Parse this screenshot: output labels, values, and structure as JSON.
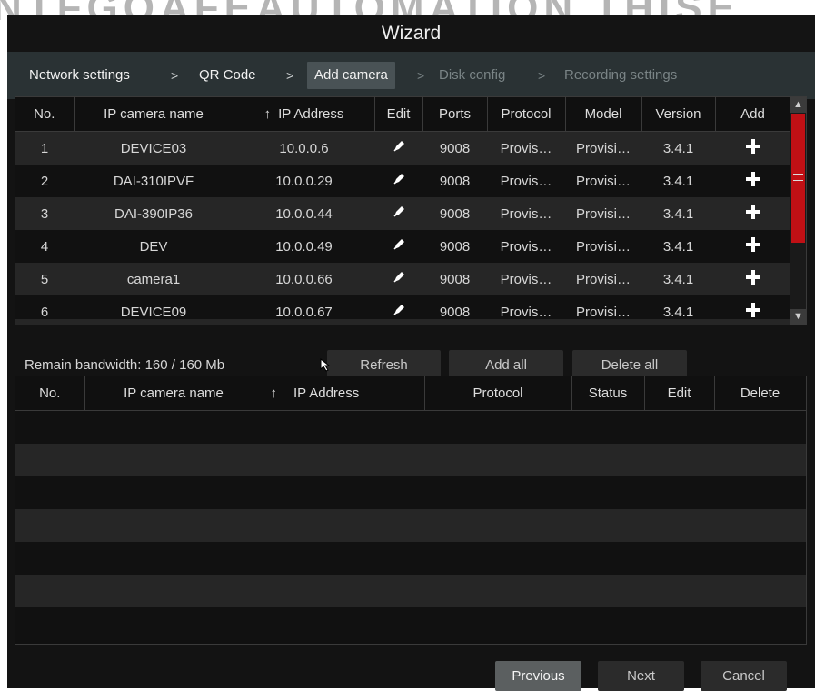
{
  "window": {
    "title": "Wizard"
  },
  "steps": [
    {
      "label": "Network settings",
      "state": "done"
    },
    {
      "label": "QR Code",
      "state": "done"
    },
    {
      "label": "Add camera",
      "state": "active"
    },
    {
      "label": "Disk config",
      "state": "disabled"
    },
    {
      "label": "Recording settings",
      "state": "disabled"
    }
  ],
  "step_separator": ">",
  "upper_table": {
    "headers": [
      "No.",
      "IP camera name",
      "IP Address",
      "Edit",
      "Ports",
      "Protocol",
      "Model",
      "Version",
      "Add"
    ],
    "sort_indicator": "↑",
    "rows": [
      {
        "no": "1",
        "name": "DEVICE03",
        "ip": "10.0.0.6",
        "port": "9008",
        "protocol": "Provis…",
        "model": "Provisi…",
        "version": "3.4.1"
      },
      {
        "no": "2",
        "name": "DAI-310IPVF",
        "ip": "10.0.0.29",
        "port": "9008",
        "protocol": "Provis…",
        "model": "Provisi…",
        "version": "3.4.1"
      },
      {
        "no": "3",
        "name": "DAI-390IP36",
        "ip": "10.0.0.44",
        "port": "9008",
        "protocol": "Provis…",
        "model": "Provisi…",
        "version": "3.4.1"
      },
      {
        "no": "4",
        "name": "DEV",
        "ip": "10.0.0.49",
        "port": "9008",
        "protocol": "Provis…",
        "model": "Provisi…",
        "version": "3.4.1"
      },
      {
        "no": "5",
        "name": "camera1",
        "ip": "10.0.0.66",
        "port": "9008",
        "protocol": "Provis…",
        "model": "Provisi…",
        "version": "3.4.1"
      },
      {
        "no": "6",
        "name": "DEVICE09",
        "ip": "10.0.0.67",
        "port": "9008",
        "protocol": "Provis…",
        "model": "Provisi…",
        "version": "3.4.1"
      }
    ]
  },
  "actions": {
    "remain_bandwidth": "Remain bandwidth: 160 / 160 Mb",
    "refresh": "Refresh",
    "add_all": "Add all",
    "delete_all": "Delete all"
  },
  "lower_table": {
    "headers": [
      "No.",
      "IP camera name",
      "IP Address",
      "Protocol",
      "Status",
      "Edit",
      "Delete"
    ],
    "sort_indicator": "↑"
  },
  "footer": {
    "previous": "Previous",
    "next": "Next",
    "cancel": "Cancel"
  },
  "colors": {
    "accent_scrollbar": "#c01015",
    "step_bar": "#2a3234",
    "background": "#131313"
  }
}
